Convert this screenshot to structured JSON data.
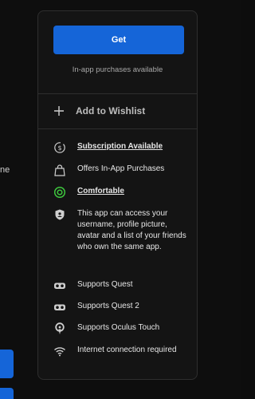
{
  "background": {
    "left_fragment_text": "ne"
  },
  "purchase": {
    "get_label": "Get",
    "iap_note": "In-app purchases available",
    "wishlist_label": "Add to Wishlist"
  },
  "features": [
    {
      "icon": "subscription-icon",
      "text": "Subscription Available",
      "link": true
    },
    {
      "icon": "shopping-bag-icon",
      "text": "Offers In-App Purchases",
      "link": false
    },
    {
      "icon": "comfort-rating-icon",
      "text": "Comfortable",
      "link": true,
      "color": "#3ec83e"
    },
    {
      "icon": "shield-icon",
      "text": "This app can access your username, profile picture, avatar and a list of your friends who own the same app.",
      "link": false
    },
    {
      "icon": "vr-headset-icon",
      "text": "Supports Quest",
      "link": false
    },
    {
      "icon": "vr-headset-icon",
      "text": "Supports Quest 2",
      "link": false
    },
    {
      "icon": "touch-controller-icon",
      "text": "Supports Oculus Touch",
      "link": false
    },
    {
      "icon": "wifi-icon",
      "text": "Internet connection required",
      "link": false
    }
  ],
  "colors": {
    "accent": "#1565d8",
    "comfort": "#3ec83e"
  }
}
